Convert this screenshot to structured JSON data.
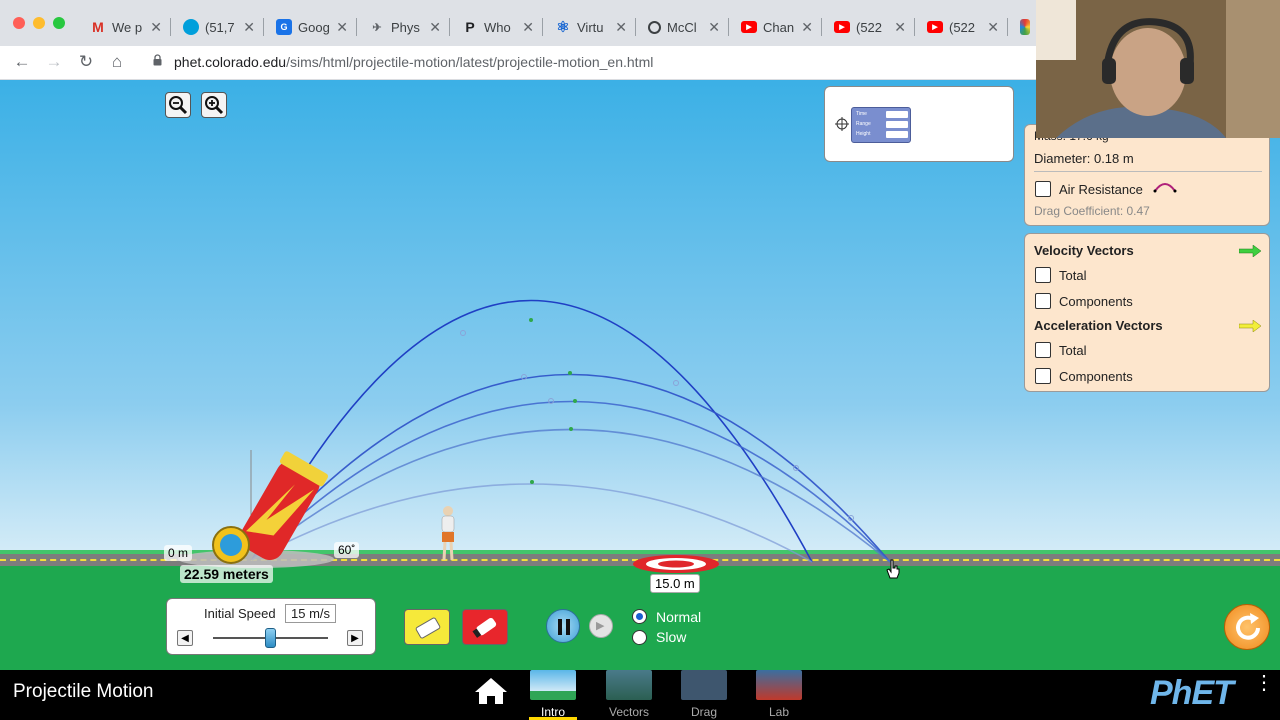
{
  "browser": {
    "tabs": [
      {
        "label": "We p",
        "icon": "gmail-icon",
        "color": "#d93025",
        "glyph": "M"
      },
      {
        "label": "(51,7",
        "icon": "att-icon",
        "color": "#009fdb",
        "glyph": "◎"
      },
      {
        "label": "Goog",
        "icon": "google-forms-icon",
        "color": "#1a73e8",
        "glyph": "G"
      },
      {
        "label": "Phys",
        "icon": "physics-icon",
        "color": "#5f6368",
        "glyph": "✈"
      },
      {
        "label": "Who",
        "icon": "p-icon",
        "color": "#202124",
        "glyph": "P"
      },
      {
        "label": "Virtu",
        "icon": "atom-icon",
        "color": "#1967d2",
        "glyph": "⚛"
      },
      {
        "label": "McCl",
        "icon": "globe-icon",
        "color": "#3c4043",
        "glyph": "◍"
      },
      {
        "label": "Chan",
        "icon": "youtube-icon",
        "color": "#ff0000",
        "glyph": "▶"
      },
      {
        "label": "(522",
        "icon": "youtube-icon",
        "color": "#ff0000",
        "glyph": "▶"
      },
      {
        "label": "(522",
        "icon": "youtube-icon",
        "color": "#ff0000",
        "glyph": "▶"
      }
    ],
    "url_domain": "phet.colorado.edu",
    "url_path": "/sims/html/projectile-motion/latest/projectile-motion_en.html"
  },
  "sim": {
    "datatool": {
      "rows": [
        "Time",
        "Range",
        "Height"
      ]
    },
    "projectile_panel": {
      "mass": "Mass: 17.6 kg",
      "diameter": "Diameter: 0.18 m",
      "air_resistance": "Air Resistance",
      "drag": "Drag Coefficient: 0.47"
    },
    "vectors_panel": {
      "velocity_title": "Velocity Vectors",
      "velocity_total": "Total",
      "velocity_components": "Components",
      "accel_title": "Acceleration Vectors",
      "accel_total": "Total",
      "accel_components": "Components"
    },
    "origin_label": "0 m",
    "angle_label": "60˚",
    "tape_label": "22.59 meters",
    "target_label": "15.0 m",
    "initial_speed_label": "Initial Speed",
    "initial_speed_value": "15 m/s",
    "initial_speed_fraction": 0.5,
    "speed_normal": "Normal",
    "speed_slow": "Slow",
    "speed_selected": "Normal"
  },
  "navbar": {
    "title": "Projectile Motion",
    "screens": [
      {
        "label": "Intro",
        "selected": true
      },
      {
        "label": "Vectors",
        "selected": false
      },
      {
        "label": "Drag",
        "selected": false
      },
      {
        "label": "Lab",
        "selected": false
      }
    ],
    "brand": "PhET"
  },
  "colors": {
    "sky": "#3bb0e6",
    "grass": "#1ea84f",
    "trajectory": "#1f3fc4",
    "panel": "#fde6cd",
    "cannon": "#e02828"
  }
}
